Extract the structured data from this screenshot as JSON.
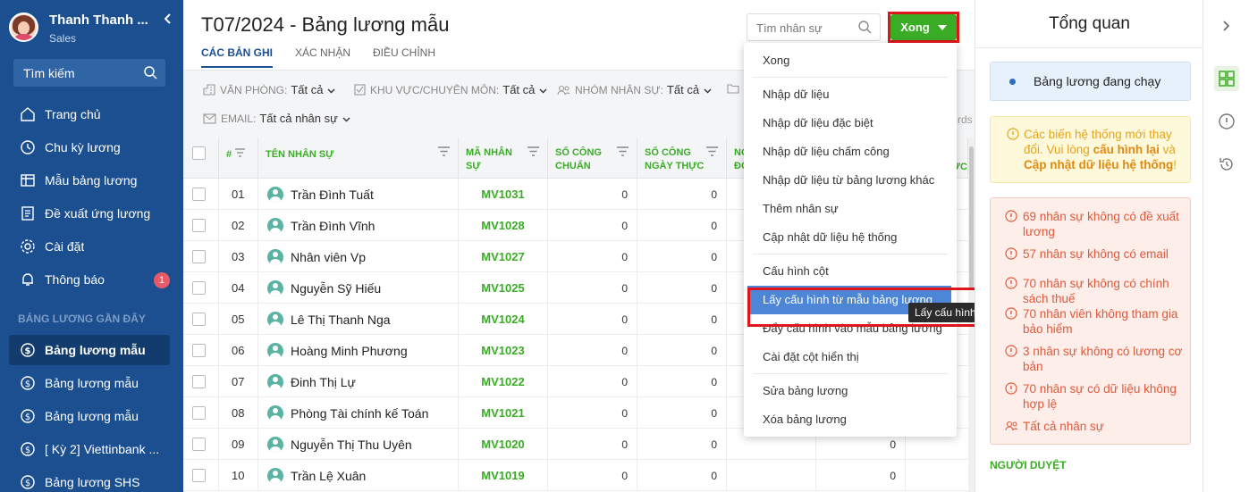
{
  "sidebar": {
    "user_name": "Thanh Thanh ...",
    "user_role": "Sales",
    "search_label": "Tìm kiếm",
    "badge": "1",
    "items": [
      {
        "label": "Trang chủ",
        "icon": "home-icon"
      },
      {
        "label": "Chu kỳ lương",
        "icon": "cycle-icon"
      },
      {
        "label": "Mẫu bảng lương",
        "icon": "template-icon"
      },
      {
        "label": "Đề xuất ứng lương",
        "icon": "document-icon"
      },
      {
        "label": "Cài đặt",
        "icon": "gear-icon"
      },
      {
        "label": "Thông báo",
        "icon": "bell-icon"
      }
    ],
    "recent_label": "BẢNG LƯƠNG GẦN ĐÂY",
    "recent": [
      {
        "label": "Bảng lương mẫu",
        "active": true
      },
      {
        "label": "Bảng lương mẫu",
        "active": false
      },
      {
        "label": "Bảng lương mẫu",
        "active": false
      },
      {
        "label": "[ Kỳ 2] Viettinbank ...",
        "active": false
      },
      {
        "label": "Bảng lương SHS",
        "active": false
      }
    ]
  },
  "header": {
    "title": "T07/2024 - Bảng lương mẫu",
    "tabs": [
      "CÁC BẢN GHI",
      "XÁC NHẬN",
      "ĐIỀU CHỈNH"
    ],
    "search_placeholder": "Tìm nhân sự",
    "done_label": "Xong"
  },
  "filters": {
    "office_label": "VĂN PHÒNG:",
    "office_value": "Tất cả",
    "area_label": "KHU VỰC/CHUYÊN MÔN:",
    "area_value": "Tất cả",
    "group_label": "NHÓM NHÂN SỰ:",
    "group_value": "Tất cả",
    "email_label": "EMAIL:",
    "email_value": "Tất cả nhân sự",
    "right_fragment": "rds"
  },
  "table": {
    "columns": [
      "#",
      "TÊN NHÂN SỰ",
      "MÃ NHÂN SỰ",
      "SỐ CÔNG CHUẨN",
      "SỐ CÔNG NGÀY THỰC",
      "NG ĐƠ",
      "",
      "ỰC"
    ],
    "rows": [
      {
        "no": "01",
        "name": "Trần Đình Tuất",
        "code": "MV1031",
        "c1": "0",
        "c2": "0",
        "c4": ""
      },
      {
        "no": "02",
        "name": "Trần Đình Vĩnh",
        "code": "MV1028",
        "c1": "0",
        "c2": "0",
        "c4": ""
      },
      {
        "no": "03",
        "name": "Nhân viên Vp",
        "code": "MV1027",
        "c1": "0",
        "c2": "0",
        "c4": ""
      },
      {
        "no": "04",
        "name": "Nguyễn Sỹ Hiếu",
        "code": "MV1025",
        "c1": "0",
        "c2": "0",
        "c4": ""
      },
      {
        "no": "05",
        "name": "Lê Thị Thanh Nga",
        "code": "MV1024",
        "c1": "0",
        "c2": "0",
        "c4": ""
      },
      {
        "no": "06",
        "name": "Hoàng Minh Phương",
        "code": "MV1023",
        "c1": "0",
        "c2": "0",
        "c4": ""
      },
      {
        "no": "07",
        "name": "Đinh Thị Lự",
        "code": "MV1022",
        "c1": "0",
        "c2": "0",
        "c4": ""
      },
      {
        "no": "08",
        "name": "Phòng Tài chính kế Toán",
        "code": "MV1021",
        "c1": "0",
        "c2": "0",
        "c4": ""
      },
      {
        "no": "09",
        "name": "Nguyễn Thị Thu Uyên",
        "code": "MV1020",
        "c1": "0",
        "c2": "0",
        "c4": "0"
      },
      {
        "no": "10",
        "name": "Trần Lệ Xuân",
        "code": "MV1019",
        "c1": "0",
        "c2": "0",
        "c4": "0"
      }
    ]
  },
  "dropdown": {
    "items": [
      "Xong",
      "Nhập dữ liệu",
      "Nhập dữ liệu đặc biệt",
      "Nhập dữ liệu chấm công",
      "Nhập dữ liệu từ bảng lương khác",
      "Thêm nhân sự",
      "Cập nhật dữ liệu hệ thống",
      "Cấu hình cột",
      "Lấy cấu hình từ mẫu bảng lương",
      "Đẩy cấu hình vào mẫu bảng lương",
      "Cài đặt cột hiển thị",
      "Sửa bảng lương",
      "Xóa bảng lương"
    ],
    "tooltip": "Lấy cấu hình từ mẫu bảng lương"
  },
  "overview": {
    "title": "Tổng quan",
    "running": "Bảng lương đang chạy",
    "warning_prefix": "Các biến hệ thống mới thay đổi. Vui lòng ",
    "warning_link1": "cấu hình lại",
    "warning_mid": " và ",
    "warning_link2": "Cập nhật dữ liệu hệ thống",
    "warning_suffix": "!",
    "errors": [
      "69 nhân sự không có đề xuất lương",
      "57 nhân sự không có email",
      "70 nhân sự không có chính sách thuế",
      "70 nhân viên không tham gia bảo hiểm",
      "3 nhân sự không có lương cơ bản",
      "70 nhân sự có dữ liệu không hợp lệ"
    ],
    "all_staff": "Tất cả nhân sự",
    "approver": "NGƯỜI DUYỆT"
  },
  "colors": {
    "sidebar": "#1b4f8f",
    "accent_green": "#3aac26",
    "highlight": "#4d86d6",
    "alert_red": "#e0151b"
  }
}
